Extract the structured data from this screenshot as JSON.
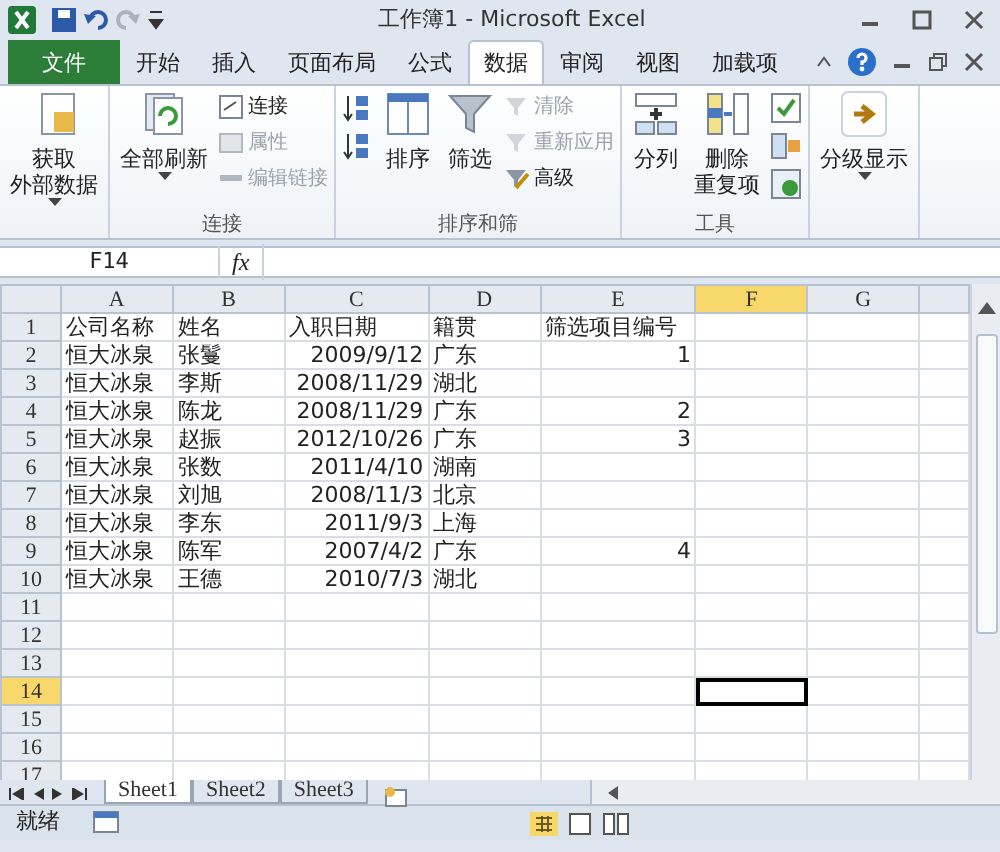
{
  "window": {
    "title": "工作簿1 - Microsoft Excel"
  },
  "ribbon_tabs": [
    {
      "label": "文件",
      "kind": "file",
      "selected": false
    },
    {
      "label": "开始",
      "kind": "tab",
      "selected": false
    },
    {
      "label": "插入",
      "kind": "tab",
      "selected": false
    },
    {
      "label": "页面布局",
      "kind": "tab",
      "selected": false
    },
    {
      "label": "公式",
      "kind": "tab",
      "selected": false
    },
    {
      "label": "数据",
      "kind": "tab",
      "selected": true
    },
    {
      "label": "审阅",
      "kind": "tab",
      "selected": false
    },
    {
      "label": "视图",
      "kind": "tab",
      "selected": false
    },
    {
      "label": "加载项",
      "kind": "tab",
      "selected": false
    }
  ],
  "ribbon_groups": [
    {
      "items": [
        {
          "kind": "large",
          "lines": [
            "获取",
            "外部数据"
          ],
          "dropdown": true,
          "disabled": false
        }
      ]
    },
    {
      "label": "连接",
      "items": [
        {
          "kind": "large",
          "lines": [
            "全部刷新"
          ],
          "dropdown": true,
          "disabled": false
        },
        {
          "kind": "small",
          "label": "连接",
          "disabled": false
        },
        {
          "kind": "small",
          "label": "属性",
          "disabled": true
        },
        {
          "kind": "small",
          "label": "编辑链接",
          "disabled": true
        }
      ]
    },
    {
      "label": "排序和筛",
      "items": [
        {
          "kind": "icon",
          "disabled": false
        },
        {
          "kind": "icon",
          "disabled": false
        },
        {
          "kind": "large",
          "lines": [
            "排序"
          ],
          "dropdown": false,
          "disabled": false
        },
        {
          "kind": "large",
          "lines": [
            "筛选"
          ],
          "dropdown": false,
          "disabled": false
        },
        {
          "kind": "small",
          "label": "清除",
          "disabled": true
        },
        {
          "kind": "small",
          "label": "重新应用",
          "disabled": true
        },
        {
          "kind": "small",
          "label": "高级",
          "disabled": false
        }
      ]
    },
    {
      "label": "工具",
      "items": [
        {
          "kind": "large",
          "lines": [
            "分列"
          ],
          "dropdown": false,
          "disabled": false
        },
        {
          "kind": "large",
          "lines": [
            "删除",
            "重复项"
          ],
          "dropdown": false,
          "disabled": false
        },
        {
          "kind": "icon",
          "disabled": false
        },
        {
          "kind": "icon",
          "disabled": false
        },
        {
          "kind": "icon",
          "disabled": false
        }
      ]
    },
    {
      "items": [
        {
          "kind": "large",
          "lines": [
            "分级显示"
          ],
          "dropdown": true,
          "disabled": false
        }
      ]
    }
  ],
  "formula_bar": {
    "name_box": "F14",
    "function_label": "fx"
  },
  "columns": [
    {
      "letter": "A",
      "selected": false
    },
    {
      "letter": "B",
      "selected": false
    },
    {
      "letter": "C",
      "numeric": true,
      "selected": false
    },
    {
      "letter": "D",
      "selected": false
    },
    {
      "letter": "E",
      "numeric": true,
      "selected": false
    },
    {
      "letter": "F",
      "selected": true
    },
    {
      "letter": "G",
      "selected": false
    }
  ],
  "header_row": {
    "number": "1",
    "selected": false,
    "cells": [
      "公司名称",
      "姓名",
      "入职日期",
      "籍贯",
      "筛选项目编号"
    ]
  },
  "rows": [
    {
      "number": "2",
      "selected": false,
      "cells": [
        "恒大冰泉",
        "张鬘",
        "2009/9/12",
        "广东",
        "1"
      ]
    },
    {
      "number": "3",
      "selected": false,
      "cells": [
        "恒大冰泉",
        "李斯",
        "2008/11/29",
        "湖北",
        null
      ]
    },
    {
      "number": "4",
      "selected": false,
      "cells": [
        "恒大冰泉",
        "陈龙",
        "2008/11/29",
        "广东",
        "2"
      ]
    },
    {
      "number": "5",
      "selected": false,
      "cells": [
        "恒大冰泉",
        "赵振",
        "2012/10/26",
        "广东",
        "3"
      ]
    },
    {
      "number": "6",
      "selected": false,
      "cells": [
        "恒大冰泉",
        "张数",
        "2011/4/10",
        "湖南",
        null
      ]
    },
    {
      "number": "7",
      "selected": false,
      "cells": [
        "恒大冰泉",
        "刘旭",
        "2008/11/3",
        "北京",
        null
      ]
    },
    {
      "number": "8",
      "selected": false,
      "cells": [
        "恒大冰泉",
        "李东",
        "2011/9/3",
        "上海",
        null
      ]
    },
    {
      "number": "9",
      "selected": false,
      "cells": [
        "恒大冰泉",
        "陈军",
        "2007/4/2",
        "广东",
        "4"
      ]
    },
    {
      "number": "10",
      "selected": false,
      "cells": [
        "恒大冰泉",
        "王德",
        "2010/7/3",
        "湖北",
        null
      ]
    },
    {
      "number": "11",
      "selected": false
    },
    {
      "number": "12",
      "selected": false
    },
    {
      "number": "13",
      "selected": false
    },
    {
      "number": "14",
      "selected": true
    },
    {
      "number": "15",
      "selected": false
    },
    {
      "number": "16",
      "selected": false
    },
    {
      "number": "17",
      "selected": false
    }
  ],
  "sheet_tabs": [
    {
      "label": "Sheet1",
      "selected": true
    },
    {
      "label": "Sheet2",
      "selected": false
    },
    {
      "label": "Sheet3",
      "selected": false
    }
  ],
  "status_bar": {
    "text": "就绪"
  }
}
